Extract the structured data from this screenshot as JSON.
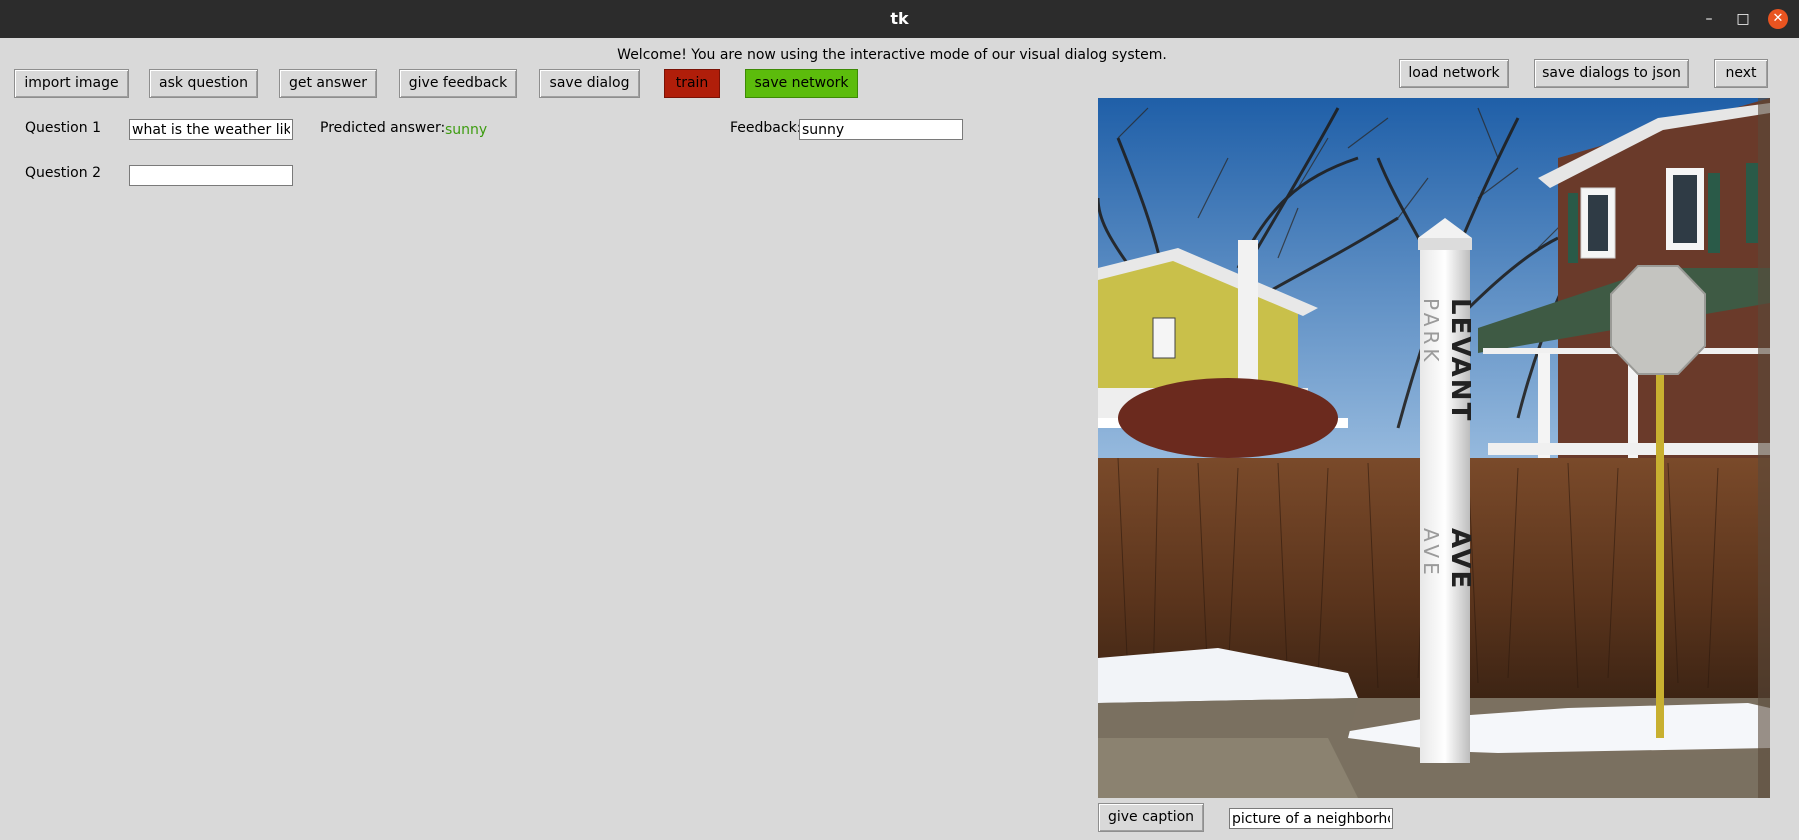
{
  "window": {
    "title": "tk",
    "controls": {
      "minimize": "–",
      "maximize": "□",
      "close": "✕"
    }
  },
  "welcome_text": "Welcome! You are now using the interactive mode of our visual dialog system.",
  "toolbar": {
    "import_image": "import image",
    "ask_question": "ask question",
    "get_answer": "get answer",
    "give_feedback": "give feedback",
    "save_dialog": "save dialog",
    "train": "train",
    "save_network": "save network",
    "load_network": "load network",
    "save_dialogs_to_json": "save dialogs to json",
    "next": "next"
  },
  "dialog": {
    "rows": [
      {
        "question_label": "Question 1",
        "question_value": "what is the weather like",
        "predicted_answer_label": "Predicted answer:",
        "predicted_answer": "sunny",
        "feedback_label": "Feedback:",
        "feedback_value": "sunny"
      },
      {
        "question_label": "Question 2",
        "question_value": ""
      }
    ]
  },
  "image_panel": {
    "sign_text_vertical": "LEVANT",
    "sign_text_vertical_2": "AVE",
    "sign_text_faded": "PARK",
    "sign_text_faded_2": "AVE",
    "give_caption_label": "give caption",
    "caption_value": "picture of a neighborhood"
  },
  "colors": {
    "background": "#d9d9d9",
    "titlebar": "#2c2c2c",
    "train_button": "#b01e0a",
    "save_network_button": "#5cbc0c",
    "answer_text": "#3d9c10",
    "close_button": "#e95420"
  }
}
